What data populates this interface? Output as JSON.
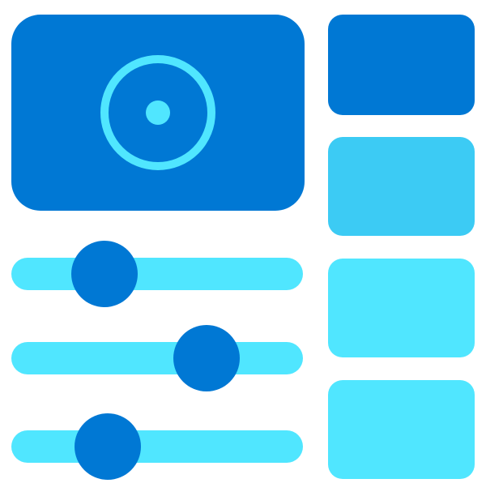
{
  "colors": {
    "primary": "#0078D4",
    "accent": "#50E6FF",
    "thumb_selected": "#0078D4",
    "thumb_secondary": "#3CCBF4",
    "thumb_default": "#50E6FF",
    "track": "#50E6FF",
    "knob": "#0078D4"
  },
  "preview": {
    "icon": "record-icon"
  },
  "thumbnails": [
    {
      "name": "thumbnail-1",
      "state": "selected"
    },
    {
      "name": "thumbnail-2",
      "state": "secondary"
    },
    {
      "name": "thumbnail-3",
      "state": "default"
    },
    {
      "name": "thumbnail-4",
      "state": "default"
    }
  ],
  "sliders": [
    {
      "name": "slider-1",
      "value": 0.32
    },
    {
      "name": "slider-2",
      "value": 0.67
    },
    {
      "name": "slider-3",
      "value": 0.33
    }
  ]
}
